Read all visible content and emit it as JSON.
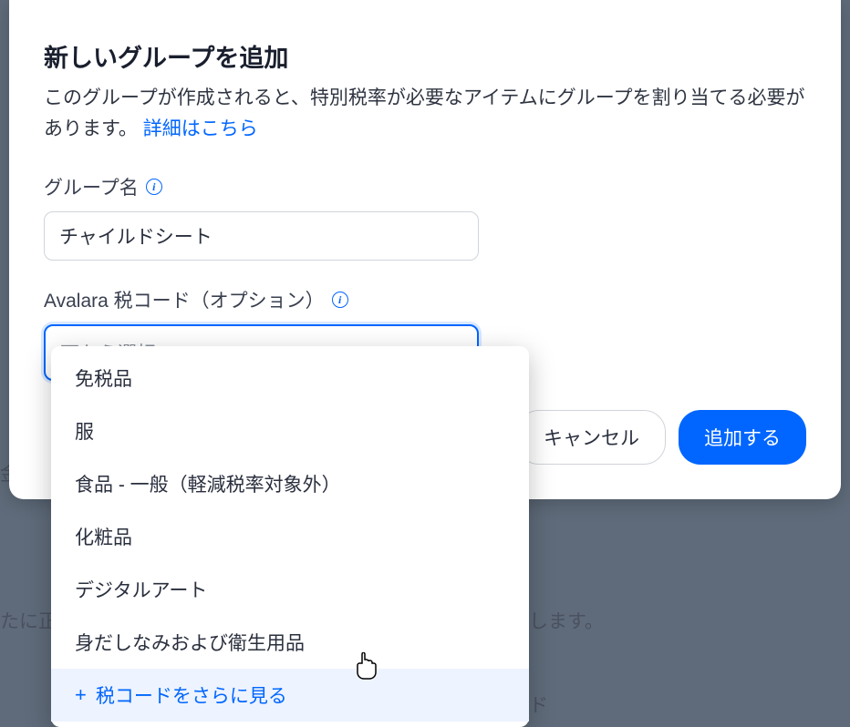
{
  "modal": {
    "title": "新しいグループを追加",
    "description_part1": "このグループが作成されると、特別税率が必要なアイテムにグループを割り当てる必要があります。",
    "description_link": "詳細はこちら",
    "group_name": {
      "label": "グループ名",
      "value": "チャイルドシート"
    },
    "tax_code": {
      "label": "Avalara 税コード（オプション）",
      "placeholder": "下から選択",
      "options": [
        "免税品",
        "服",
        "食品 - 一般（軽減税率対象外）",
        "化粧品",
        "デジタルアート",
        "身だしなみおよび衛生用品"
      ],
      "more_label": "税コードをさらに見る"
    },
    "buttons": {
      "cancel": "キャンセル",
      "submit": "追加する"
    }
  },
  "background": {
    "text1": "金が含",
    "text2": "たに正",
    "text3": "します。",
    "text4": "ド"
  }
}
